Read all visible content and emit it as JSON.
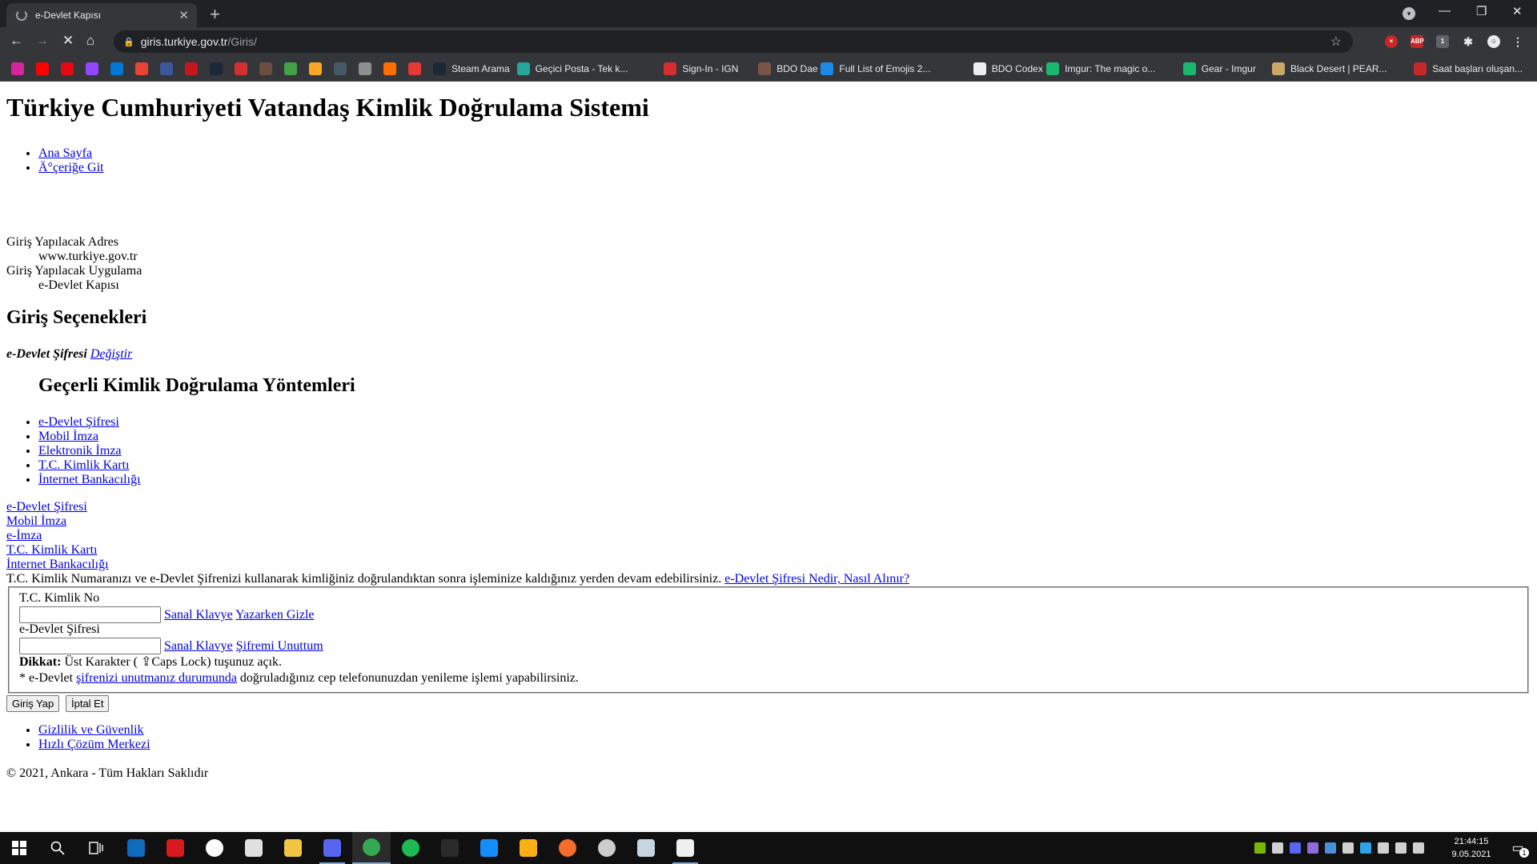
{
  "browser": {
    "tab_title": "e-Devlet Kapısı",
    "url_host": "giris.turkiye.gov.tr",
    "url_path": "/Giris/",
    "bookmarks": [
      {
        "label": "",
        "color": "#d6249f"
      },
      {
        "label": "",
        "color": "#ff0000"
      },
      {
        "label": "",
        "color": "#e50914"
      },
      {
        "label": "",
        "color": "#9146ff"
      },
      {
        "label": "",
        "color": "#0078d4"
      },
      {
        "label": "",
        "color": "#ea4335"
      },
      {
        "label": "",
        "color": "#3b5998"
      },
      {
        "label": "",
        "color": "#c7161d"
      },
      {
        "label": "",
        "color": "#1b2838"
      },
      {
        "label": "",
        "color": "#d32f2f"
      },
      {
        "label": "",
        "color": "#6d4c41"
      },
      {
        "label": "",
        "color": "#43a047"
      },
      {
        "label": "",
        "color": "#f9a825"
      },
      {
        "label": "",
        "color": "#455a64"
      },
      {
        "label": "",
        "color": "#8e8e8e"
      },
      {
        "label": "",
        "color": "#ff6f00"
      },
      {
        "label": "",
        "color": "#e53935"
      },
      {
        "label": "Steam Arama",
        "color": "#1b2838"
      },
      {
        "label": "Geçici Posta - Tek k...",
        "color": "#26a69a"
      },
      {
        "label": "Sign-In - IGN",
        "color": "#d32f2f"
      },
      {
        "label": "BDO Dae",
        "color": "#795548"
      },
      {
        "label": "Full List of Emojis 2...",
        "color": "#1e88e5"
      },
      {
        "label": "BDO Codex",
        "color": "#eeeeee"
      },
      {
        "label": "Imgur: The magic o...",
        "color": "#1bb76e"
      },
      {
        "label": "Gear - Imgur",
        "color": "#1bb76e"
      },
      {
        "label": "Black Desert | PEAR...",
        "color": "#c9a86a"
      },
      {
        "label": "Saat başları oluşan...",
        "color": "#c62828"
      }
    ]
  },
  "page": {
    "title": "Türkiye Cumhuriyeti Vatandaş Kimlik Doğrulama Sistemi",
    "top_links": [
      "Ana Sayfa",
      "Ä°çeriğe Git"
    ],
    "info": {
      "address_label": "Giriş Yapılacak Adres",
      "address_value": "www.turkiye.gov.tr",
      "app_label": "Giriş Yapılacak Uygulama",
      "app_value": "e-Devlet Kapısı"
    },
    "options_heading": "Giriş Seçenekleri",
    "selected_method": "e-Devlet Şifresi",
    "change_link": "Değiştir",
    "methods_heading": "Geçerli Kimlik Doğrulama Yöntemleri",
    "methods": [
      "e-Devlet Şifresi",
      "Mobil İmza",
      "Elektronik İmza",
      "T.C. Kimlik Kartı",
      "İnternet Bankacılığı"
    ],
    "tabs": [
      "e-Devlet Şifresi",
      "Mobil İmza",
      "e-İmza",
      "T.C. Kimlik Kartı",
      "İnternet Bankacılığı"
    ],
    "intro_text": "T.C. Kimlik Numaranızı ve e-Devlet Şifrenizi kullanarak kimliğiniz doğrulandıktan sonra işleminize kaldığınız yerden devam edebilirsiniz.",
    "intro_link": "e-Devlet Şifresi Nedir, Nasıl Alınır?",
    "form": {
      "tc_label": "T.C. Kimlik No",
      "tc_value": "",
      "virtual_keyboard": "Sanal Klavye",
      "hide_typing": "Yazarken Gizle",
      "password_label": "e-Devlet Şifresi",
      "password_value": "",
      "forgot_password": "Şifremi Unuttum",
      "warning_bold": "Dikkat:",
      "warning_text": "Üst Karakter ( ⇪Caps Lock) tuşunuz açık.",
      "note_prefix": "* e-Devlet",
      "note_link": "şifrenizi unutmanız durumunda",
      "note_suffix": "doğruladığınız cep telefonunuzdan yenileme işlemi yapabilirsiniz."
    },
    "login_button": "Giriş Yap",
    "cancel_button": "İptal Et",
    "footer_links": [
      "Gizlilik ve Güvenlik",
      "Hızlı Çözüm Merkezi"
    ],
    "copyright": "© 2021, Ankara - Tüm Hakları Saklıdır"
  },
  "taskbar": {
    "apps": [
      {
        "name": "outlook",
        "color": "#0f6cbd"
      },
      {
        "name": "bolt",
        "color": "#d71920"
      },
      {
        "name": "xbox",
        "color": "#ffffff"
      },
      {
        "name": "store",
        "color": "#e0e0e0"
      },
      {
        "name": "explorer",
        "color": "#f4c542"
      },
      {
        "name": "discord",
        "color": "#5865f2"
      },
      {
        "name": "chrome",
        "color": "#34a853"
      },
      {
        "name": "spotify",
        "color": "#1db954"
      },
      {
        "name": "epic",
        "color": "#2a2a2a"
      },
      {
        "name": "battlenet",
        "color": "#148eff"
      },
      {
        "name": "rockstar",
        "color": "#fcaf17"
      },
      {
        "name": "origin",
        "color": "#f56c2d"
      },
      {
        "name": "ubisoft",
        "color": "#cccccc"
      },
      {
        "name": "steam",
        "color": "#c7d5e0"
      },
      {
        "name": "app-black",
        "color": "#f0f0f0"
      }
    ],
    "time": "21:44:15",
    "date": "9.05.2021",
    "notification_count": "1"
  }
}
